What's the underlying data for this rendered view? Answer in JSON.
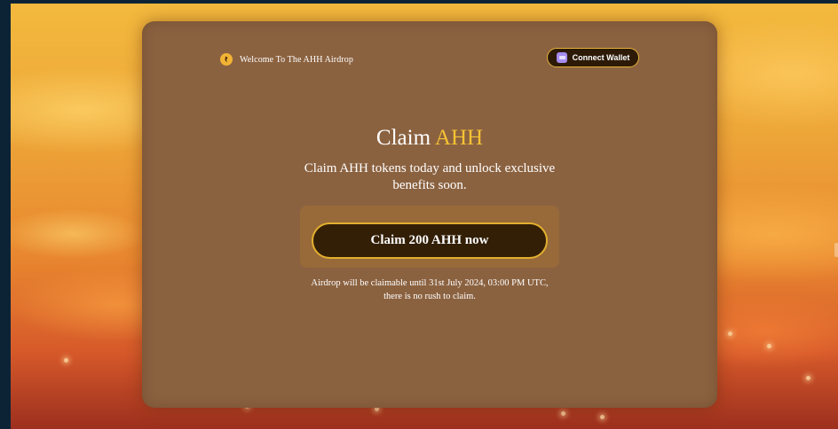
{
  "header": {
    "brand_icon": "coin-logo-icon",
    "welcome_text": "Welcome To The AHH Airdrop",
    "connect_wallet_label": "Connect Wallet",
    "connect_wallet_icon": "wallet-icon"
  },
  "hero": {
    "title_prefix": "Claim",
    "title_accent": "AHH",
    "subtitle": "Claim AHH tokens today and unlock exclusive benefits soon.",
    "claim_button_label": "Claim 200 AHH now",
    "note": "Airdrop will be claimable until 31st July 2024, 03:00 PM UTC, there is no rush to claim."
  },
  "colors": {
    "card_bg": "#8b6240",
    "accent_gold": "#f6c233",
    "button_dark": "#331f06",
    "button_border": "#e2af2e",
    "page_frame": "#0c2336"
  }
}
